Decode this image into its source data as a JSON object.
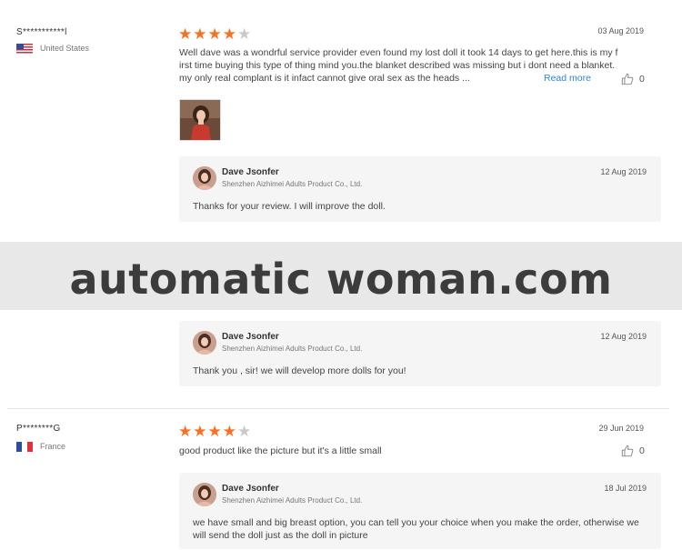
{
  "reviews": [
    {
      "name": "S***********l",
      "country": "United States",
      "country_flag": "us-flag-icon",
      "rating": 4,
      "date": "03 Aug 2019",
      "text": "Well dave was a wondrful service provider even found my lost doll it took 14 days to get here.this is my first time buying this type of thing mind you.the blanket described was missing but i dont need a blanket.my only real complant is it infact cannot give oral sex as the heads ...",
      "read_more": "Read more",
      "likes": "0",
      "has_photo": true,
      "reply": {
        "name": "Dave Jsonfer",
        "company": "Shenzhen Aizhimei Adults Product Co., Ltd.",
        "date": "12 Aug 2019",
        "text": "Thanks for your review. I will improve the doll."
      }
    },
    {
      "reply": {
        "name": "Dave Jsonfer",
        "company": "Shenzhen Aizhimei Adults Product Co., Ltd.",
        "date": "12 Aug 2019",
        "text": "Thank you , sir! we will develop more dolls for you!"
      }
    },
    {
      "name": "P********G",
      "country": "France",
      "country_flag": "fr-flag-icon",
      "rating": 4,
      "date": "29 Jun 2019",
      "text": "good product like the picture but it's a little small",
      "likes": "0",
      "reply": {
        "name": "Dave Jsonfer",
        "company": "Shenzhen Aizhimei Adults Product Co., Ltd.",
        "date": "18 Jul 2019",
        "text": "we have small and big breast option, you can tell you your choice when you make the order, otherwise we will send the doll just as the doll in picture"
      }
    }
  ],
  "watermark": "automatic woman.com",
  "colors": {
    "star": "#ff6e1f",
    "star_empty": "#c9c9c9",
    "link": "#2f86d8",
    "reply_bg": "#f5f5f5"
  }
}
